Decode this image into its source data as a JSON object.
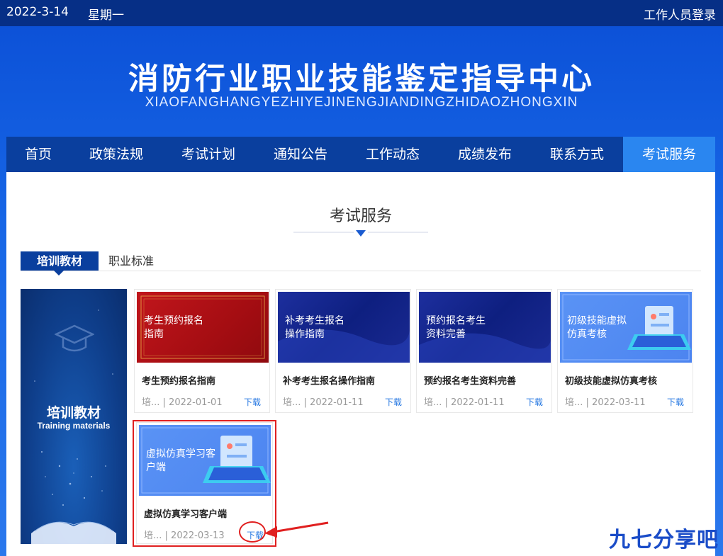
{
  "topbar": {
    "date": "2022-3-14",
    "weekday": "星期一",
    "login": "工作人员登录"
  },
  "banner": {
    "title": "消防行业职业技能鉴定指导中心",
    "subtitle": "XIAOFANGHANGYEZHIYEJINENGJIANDINGZHIDAOZHONGXIN"
  },
  "nav": [
    "首页",
    "政策法规",
    "考试计划",
    "通知公告",
    "工作动态",
    "成绩发布",
    "联系方式",
    "考试服务"
  ],
  "section_title": "考试服务",
  "tabs": {
    "active": "培训教材",
    "other": "职业标准"
  },
  "sidepanel": {
    "cn": "培训教材",
    "en": "Training materials"
  },
  "cards": [
    {
      "thumb_text": "考生预约报名指南",
      "name": "考生预约报名指南",
      "meta": "培... | 2022-01-01",
      "download": "下载"
    },
    {
      "thumb_text": "补考考生报名操作指南",
      "name": "补考考生报名操作指南",
      "meta": "培... | 2022-01-11",
      "download": "下载"
    },
    {
      "thumb_text": "预约报名考生资料完善",
      "name": "预约报名考生资料完善",
      "meta": "培... | 2022-01-11",
      "download": "下载"
    },
    {
      "thumb_text": "初级技能虚拟仿真考核",
      "name": "初级技能虚拟仿真考核",
      "meta": "培... | 2022-03-11",
      "download": "下载"
    },
    {
      "thumb_text": "虚拟仿真学习客户端",
      "name": "虚拟仿真学习客户端",
      "meta": "培... | 2022-03-13",
      "download": "下载"
    }
  ],
  "watermark": "九七分享吧",
  "colors": {
    "nav_bg": "#0a3f9e",
    "nav_active": "#2a86f0",
    "topbar_bg": "#062f86",
    "highlight": "#e02020"
  }
}
